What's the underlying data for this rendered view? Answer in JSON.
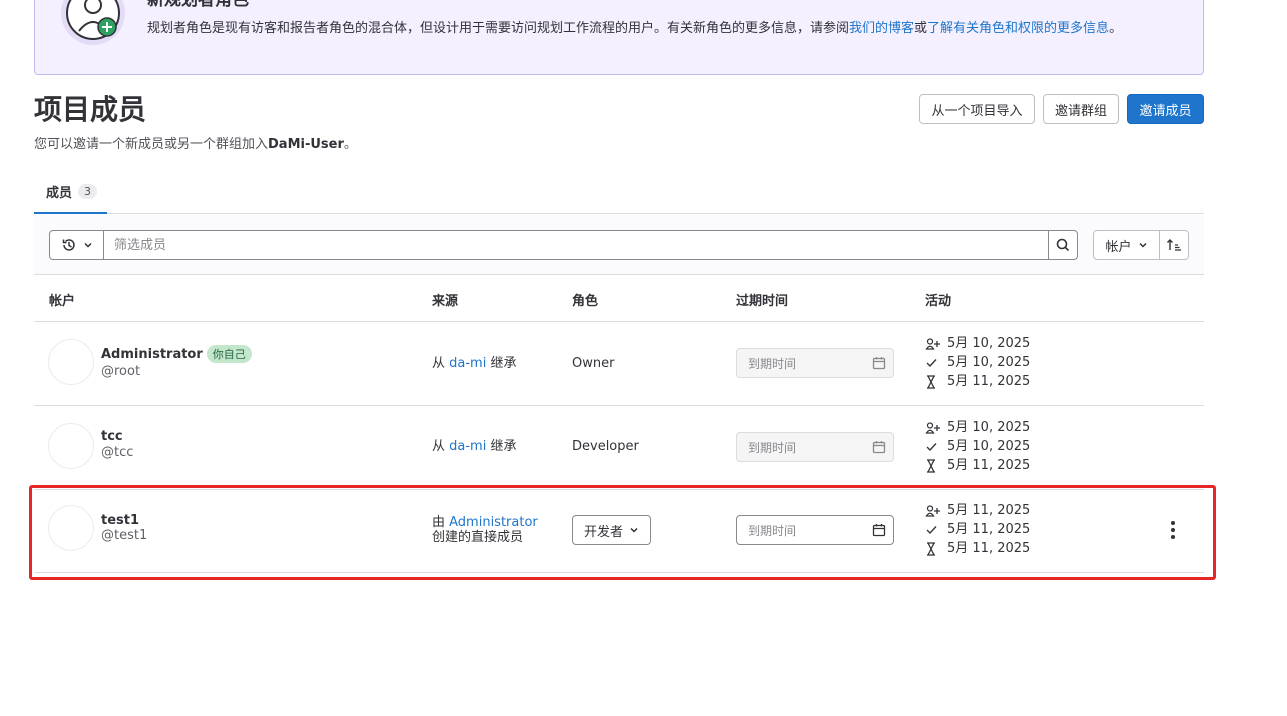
{
  "banner": {
    "title": "新规划者角色",
    "text_before": "规划者角色是现有访客和报告者角色的混合体，但设计用于需要访问规划工作流程的用户。有关新角色的更多信息，请参阅",
    "link_blog": "我们的博客",
    "text_or": "或",
    "link_roles": "了解有关角色和权限的更多信息",
    "text_end": "。"
  },
  "header": {
    "title": "项目成员",
    "subtitle_before": "您可以邀请一个新成员或另一个群组加入",
    "subtitle_project": "DaMi-User",
    "subtitle_end": "。",
    "import_label": "从一个项目导入",
    "invite_group_label": "邀请群组",
    "invite_member_label": "邀请成员"
  },
  "tabs": [
    {
      "label": "成员",
      "count": "3"
    }
  ],
  "filter": {
    "placeholder": "筛选成员",
    "sort_label": "帐户"
  },
  "table": {
    "headers": [
      "帐户",
      "来源",
      "角色",
      "过期时间",
      "活动"
    ],
    "rows": [
      {
        "name": "Administrator",
        "badge": "你自己",
        "handle": "@root",
        "source_prefix": "从 ",
        "source_link": "da-mi",
        "source_suffix": " 继承",
        "role": "Owner",
        "expiry_placeholder": "到期时间",
        "activity": [
          "5月 10, 2025",
          "5月 10, 2025",
          "5月 11, 2025"
        ]
      },
      {
        "name": "tcc",
        "handle": "@tcc",
        "source_prefix": "从 ",
        "source_link": "da-mi",
        "source_suffix": " 继承",
        "role": "Developer",
        "expiry_placeholder": "到期时间",
        "activity": [
          "5月 10, 2025",
          "5月 10, 2025",
          "5月 11, 2025"
        ]
      },
      {
        "name": "test1",
        "handle": "@test1",
        "source_prefix": "由 ",
        "source_link": "Administrator",
        "source_suffix": "创建的直接成员",
        "role": "开发者",
        "expiry_placeholder": "到期时间",
        "activity": [
          "5月 11, 2025",
          "5月 11, 2025",
          "5月 11, 2025"
        ]
      }
    ]
  },
  "colors": {
    "accent": "#1f75cb",
    "highlight": "#e52727",
    "banner_bg": "#f4f0ff",
    "self_badge_bg": "#c3e6cd"
  }
}
